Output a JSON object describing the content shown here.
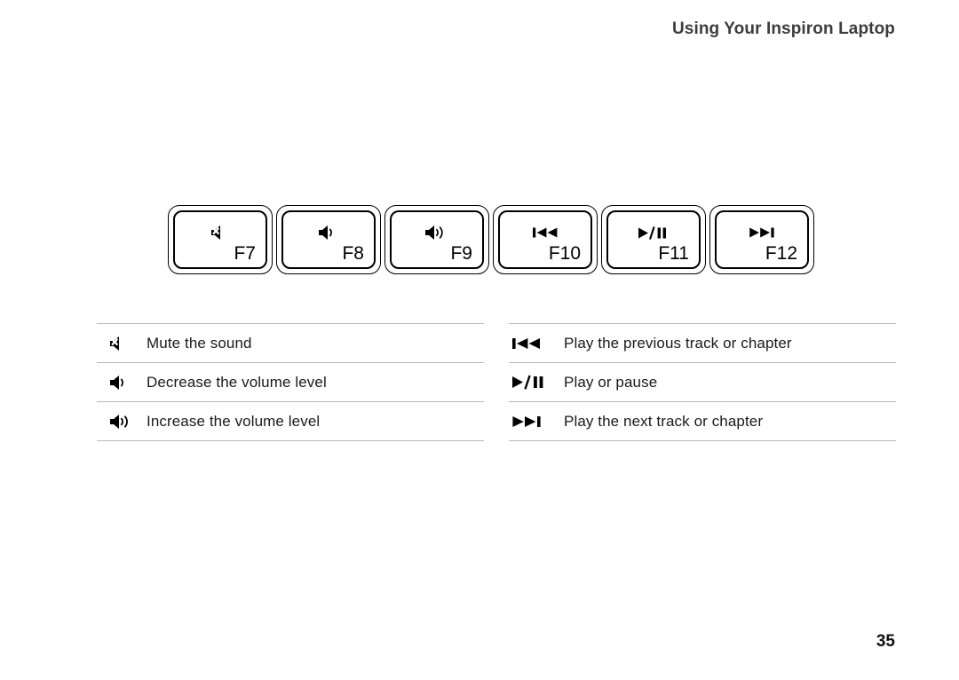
{
  "header": {
    "title": "Using Your Inspiron Laptop"
  },
  "keys": [
    {
      "label": "F7",
      "icon": "mute-icon"
    },
    {
      "label": "F8",
      "icon": "volume-down-icon"
    },
    {
      "label": "F9",
      "icon": "volume-up-icon"
    },
    {
      "label": "F10",
      "icon": "previous-track-icon"
    },
    {
      "label": "F11",
      "icon": "play-pause-icon"
    },
    {
      "label": "F12",
      "icon": "next-track-icon"
    }
  ],
  "legend_left": {
    "rows": [
      {
        "icon": "mute-icon",
        "text": "Mute the sound"
      },
      {
        "icon": "volume-down-icon",
        "text": "Decrease the volume level"
      },
      {
        "icon": "volume-up-icon",
        "text": "Increase the volume level"
      }
    ]
  },
  "legend_right": {
    "rows": [
      {
        "icon": "previous-track-icon",
        "text": "Play the previous track or chapter"
      },
      {
        "icon": "play-pause-icon",
        "text": "Play or pause"
      },
      {
        "icon": "next-track-icon",
        "text": "Play the next track or chapter"
      }
    ]
  },
  "footer": {
    "page_number": "35"
  },
  "colors": {
    "header_text": "#3d3d3d",
    "body_text": "#1a1a1a",
    "divider": "#b9b9b9",
    "key_outline": "#000000",
    "background": "#ffffff"
  }
}
